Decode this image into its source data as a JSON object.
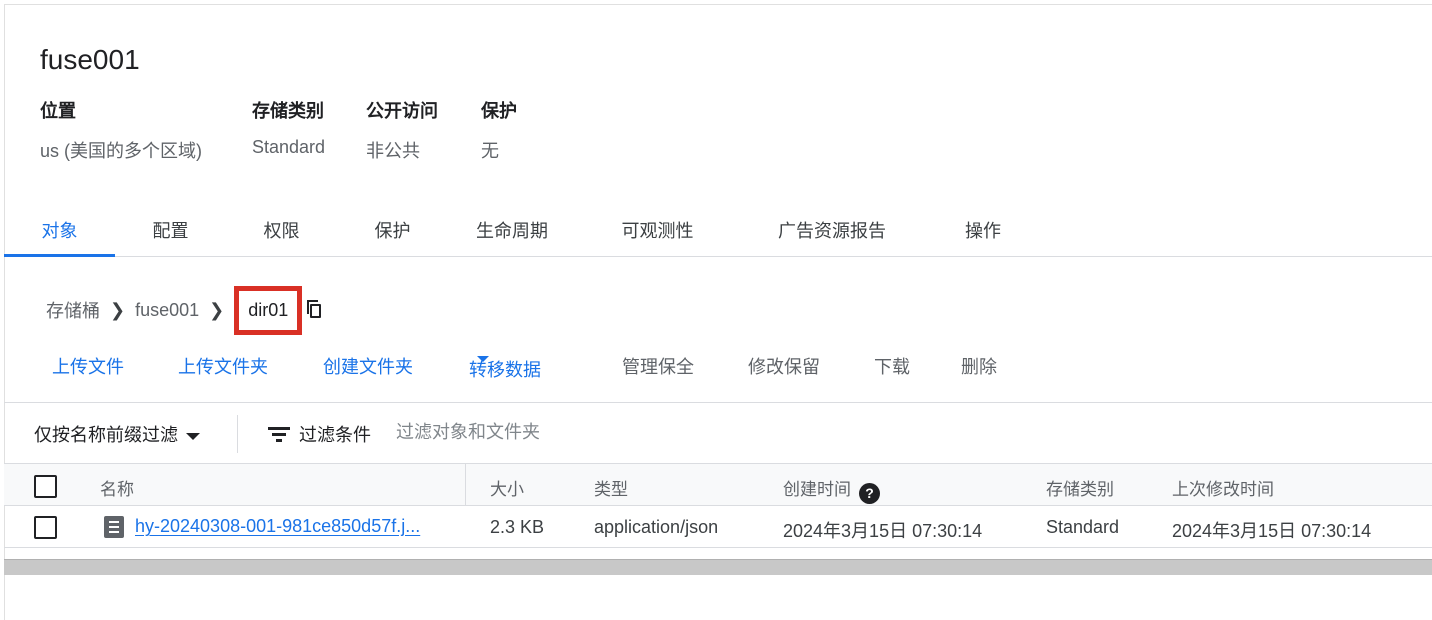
{
  "bucket": {
    "name": "fuse001",
    "meta": [
      {
        "label": "位置",
        "value": "us (美国的多个区域)"
      },
      {
        "label": "存储类别",
        "value": "Standard"
      },
      {
        "label": "公开访问",
        "value": "非公共"
      },
      {
        "label": "保护",
        "value": "无"
      }
    ]
  },
  "tabs": [
    "对象",
    "配置",
    "权限",
    "保护",
    "生命周期",
    "可观测性",
    "广告资源报告",
    "操作"
  ],
  "active_tab": "对象",
  "breadcrumb": {
    "root": "存储桶",
    "bucket": "fuse001",
    "current": "dir01",
    "copy_icon": "copy-icon"
  },
  "actions": {
    "upload_files": "上传文件",
    "upload_folder": "上传文件夹",
    "create_folder": "创建文件夹",
    "transfer_data": "转移数据",
    "manage_holds": "管理保全",
    "edit_retention": "修改保留",
    "download": "下载",
    "delete": "删除"
  },
  "filter": {
    "prefix_label": "仅按名称前缀过滤",
    "filter_label": "过滤条件",
    "placeholder": "过滤对象和文件夹"
  },
  "table": {
    "columns": {
      "name": "名称",
      "size": "大小",
      "type": "类型",
      "created": "创建时间",
      "storage_class": "存储类别",
      "last_modified": "上次修改时间"
    },
    "rows": [
      {
        "name": "hy-20240308-001-981ce850d57f.j...",
        "size": "2.3 KB",
        "type": "application/json",
        "created": "2024年3月15日 07:30:14",
        "storage_class": "Standard",
        "last_modified": "2024年3月15日 07:30:14",
        "icon": "file-icon"
      }
    ]
  },
  "colors": {
    "accent": "#1a73e8",
    "highlight_border": "#d93025"
  }
}
